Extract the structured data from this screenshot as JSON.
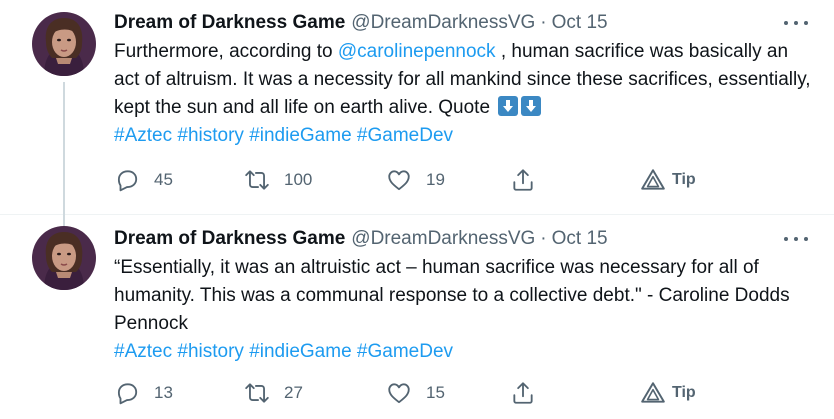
{
  "tweets": [
    {
      "author_name": "Dream of Darkness Game",
      "handle": "@DreamDarknessVG",
      "separator": "·",
      "date": "Oct 15",
      "text": {
        "line1_prefix": "Furthermore, according to ",
        "mention": "@carolinepennock",
        "line1_suffix": " , human sacrifice was basically an act of altruism. It was a necessity for all mankind since these sacrifices, essentially, kept the sun and all life on earth alive. Quote",
        "hashtags": [
          "#Aztec",
          "#history",
          "#indieGame",
          "#GameDev"
        ]
      },
      "counts": {
        "replies": "45",
        "retweets": "100",
        "likes": "19"
      },
      "tip_label": "Tip"
    },
    {
      "author_name": "Dream of Darkness Game",
      "handle": "@DreamDarknessVG",
      "separator": "·",
      "date": "Oct 15",
      "text": {
        "body": "“Essentially, it was an altruistic act – human sacrifice was necessary for all of humanity. This was a communal response to a collective debt.\" - Caroline Dodds Pennock",
        "hashtags": [
          "#Aztec",
          "#history",
          "#indieGame",
          "#GameDev"
        ]
      },
      "counts": {
        "replies": "13",
        "retweets": "27",
        "likes": "15"
      },
      "tip_label": "Tip"
    }
  ],
  "colors": {
    "link": "#1d9bf0",
    "secondary_text": "#536471",
    "emoji_bg": "#3b88c3"
  },
  "icons": [
    "avatar",
    "more-icon",
    "reply-icon",
    "retweet-icon",
    "like-icon",
    "share-icon",
    "tip-icon",
    "down-arrow-emoji"
  ]
}
